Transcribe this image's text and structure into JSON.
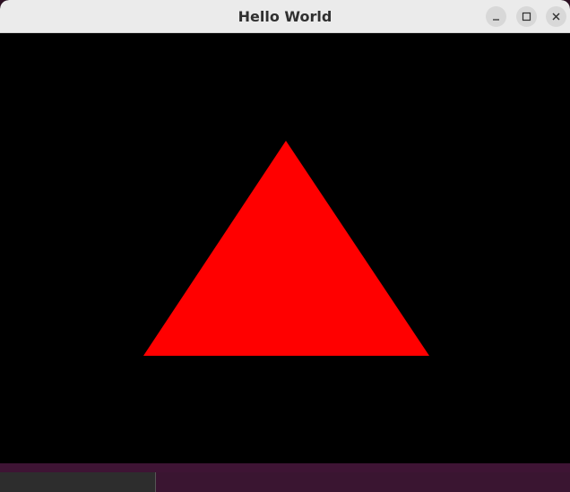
{
  "window": {
    "title": "Hello World",
    "controls": [
      "minimize-icon",
      "maximize-icon",
      "close-icon"
    ]
  },
  "scene": {
    "background_color": "#000000",
    "triangle_color": "#ff0000"
  }
}
